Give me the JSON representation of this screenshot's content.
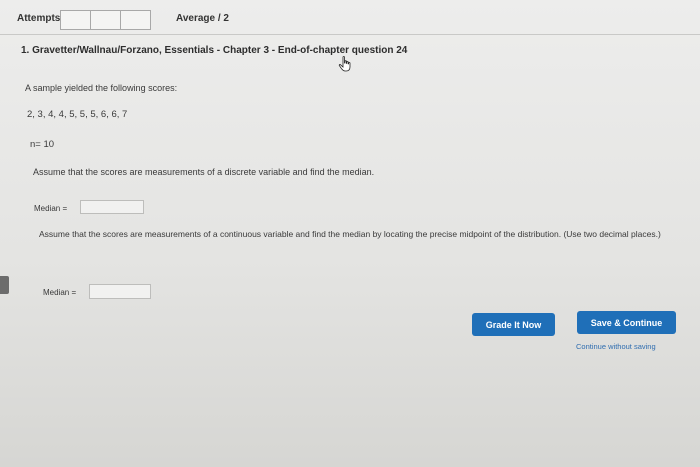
{
  "header": {
    "attempts_label": "Attempts",
    "attempt_box_count": 3,
    "average_label": "Average / 2"
  },
  "question": {
    "title": "1. Gravetter/Wallnau/Forzano, Essentials - Chapter 3 - End-of-chapter question 24",
    "prompt": "A sample yielded the following scores:",
    "scores": "2, 3, 4, 4, 5, 5, 5, 6, 6, 7",
    "n_line": "n= 10",
    "discrete_question": "Assume that the scores are measurements of a discrete variable and find the median.",
    "median_label_1": "Median =",
    "median_value_1": "",
    "continuous_question": "Assume that the scores are measurements of a continuous variable and find the median by locating the precise midpoint of the distribution. (Use two decimal places.)",
    "median_label_2": "Median =",
    "median_value_2": ""
  },
  "actions": {
    "grade_label": "Grade It Now",
    "save_label": "Save & Continue",
    "continue_link": "Continue without saving",
    "accent_color": "#1f6fb8"
  }
}
